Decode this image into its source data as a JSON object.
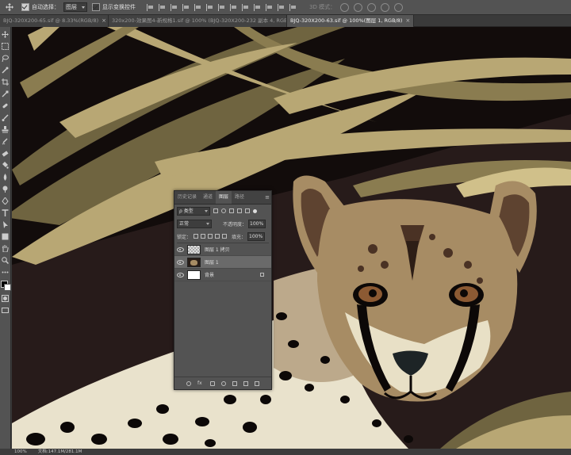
{
  "options_bar": {
    "auto_select_label": "自动选择：",
    "auto_select_value": "图层",
    "transform_label": "显示变换控件",
    "mode_3d_label": "3D 模式："
  },
  "tabs": [
    {
      "label": "BJQ-320X200-65.sif @ 8.33%(RGB/8)",
      "active": false
    },
    {
      "label": "320x200-效果图4-新规格1.sif @ 100% (BJQ-320X200-232 副本 4, RGB/8)",
      "active": false
    },
    {
      "label": "BJQ-320X200-63.sif @ 100%(图层 1, RGB/8)",
      "active": true
    }
  ],
  "status": {
    "zoom": "100%",
    "doc": "文档:147.1M/281.1M"
  },
  "layers_panel": {
    "tabs": [
      {
        "label": "历史记录",
        "active": false
      },
      {
        "label": "通道",
        "active": false
      },
      {
        "label": "图层",
        "active": true
      },
      {
        "label": "路径",
        "active": false
      }
    ],
    "filter_label": "ρ 类型",
    "blend_mode": "正常",
    "opacity_label": "不透明度：",
    "opacity_value": "100%",
    "lock_label": "锁定：",
    "fill_label": "填充：",
    "fill_value": "100%",
    "layers": [
      {
        "name": "图层 1 拷贝",
        "thumb": "checker",
        "selected": false,
        "locked": false
      },
      {
        "name": "图层 1",
        "thumb": "cat",
        "selected": true,
        "locked": false
      },
      {
        "name": "背景",
        "thumb": "white",
        "selected": false,
        "locked": true
      }
    ],
    "footer": [
      "link-icon",
      "fx-icon",
      "mask-icon",
      "adjustment-icon",
      "folder-icon",
      "new-layer-icon",
      "trash-icon"
    ]
  },
  "colors": {
    "canvas_bg": "#271b1a",
    "fur": "#a78c64",
    "leaf_gold": "#b8a774",
    "leaf_olive": "#6f6440"
  }
}
